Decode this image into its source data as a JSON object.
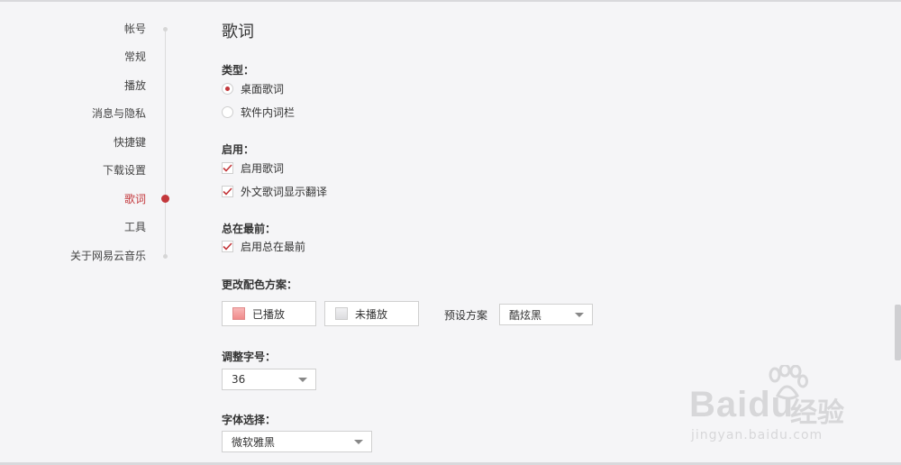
{
  "sidebar": {
    "items": [
      {
        "label": "帐号",
        "active": false
      },
      {
        "label": "常规",
        "active": false
      },
      {
        "label": "播放",
        "active": false
      },
      {
        "label": "消息与隐私",
        "active": false
      },
      {
        "label": "快捷键",
        "active": false
      },
      {
        "label": "下载设置",
        "active": false
      },
      {
        "label": "歌词",
        "active": true
      },
      {
        "label": "工具",
        "active": false
      },
      {
        "label": "关于网易云音乐",
        "active": false
      }
    ]
  },
  "main": {
    "title": "歌词",
    "type_section": {
      "label": "类型：",
      "options": [
        {
          "label": "桌面歌词",
          "selected": true
        },
        {
          "label": "软件内词栏",
          "selected": false
        }
      ]
    },
    "enable_section": {
      "label": "启用：",
      "options": [
        {
          "label": "启用歌词",
          "checked": true
        },
        {
          "label": "外文歌词显示翻译",
          "checked": true
        }
      ]
    },
    "ontop_section": {
      "label": "总在最前：",
      "options": [
        {
          "label": "启用总在最前",
          "checked": true
        }
      ]
    },
    "color_section": {
      "label": "更改配色方案：",
      "played_label": "已播放",
      "unplayed_label": "未播放",
      "preset_label": "预设方案",
      "preset_value": "酷炫黑"
    },
    "font_size_section": {
      "label": "调整字号：",
      "value": "36"
    },
    "font_section": {
      "label": "字体选择：",
      "value": "微软雅黑"
    }
  },
  "watermark": {
    "brand": "Bai",
    "brand_tail": "du",
    "cn": "经验",
    "url": "jingyan.baidu.com"
  },
  "colors": {
    "accent": "#c3373b",
    "played_swatch": "#f59a9a",
    "unplayed_swatch": "#e6e6e8"
  }
}
